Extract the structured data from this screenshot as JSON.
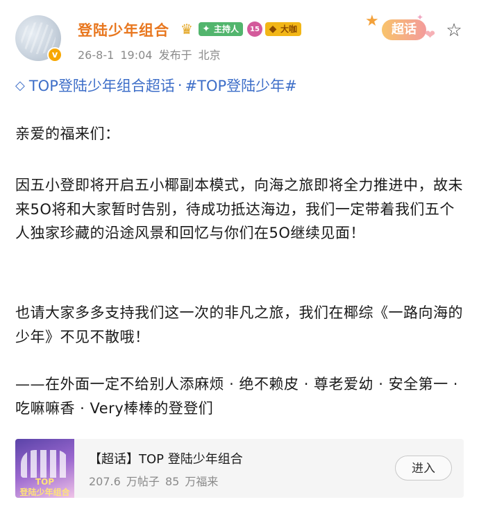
{
  "post": {
    "user_name": "登陆少年组合",
    "verified_mark": "v",
    "badges": {
      "host_label": "主持人",
      "level_label": "15",
      "fan_label": "大咖"
    },
    "timestamp": "26-8-1 19:04",
    "location": "发布于 北京",
    "chaohua_label": "超话",
    "topic_supertopic": "TOP登陆少年组合超话",
    "topic_separator": "·",
    "topic_hashtag": "#TOP登陆少年#",
    "paragraphs": [
      "亲爱的福来们：",
      "因五小登即将开启五小椰副本模式，向海之旅即将全力推进中，故未来5O将和大家暂时告别，待成功抵达海边，我们一定带着我们五个人独家珍藏的沿途风景和回忆与你们在5O继续见面！",
      "也请大家多多支持我们这一次的非凡之旅，我们在椰综《一路向海的少年》不见不散哦！",
      "——在外面一定不给别人添麻烦 · 绝不赖皮 · 尊老爱幼 · 安全第一 · 吃嘛嘛香 · Very棒棒的登登们"
    ]
  },
  "card": {
    "title": "【超话】TOP 登陆少年组合",
    "stats": "207.6 万帖子 85 万福来",
    "join_label": "进入",
    "thumb_text_line1": "TOP",
    "thumb_text_line2": "登陆少年组合"
  },
  "icons": {
    "avatar": "avatar-image",
    "crown": "crown-icon",
    "favorite": "star-outline-icon",
    "topic": "diamond-icon"
  },
  "colors": {
    "name": "#e8771f",
    "topic": "#3d6ec8",
    "host_badge": "#52b56d",
    "fan_badge": "#f2b617",
    "verified": "#f7a700"
  }
}
